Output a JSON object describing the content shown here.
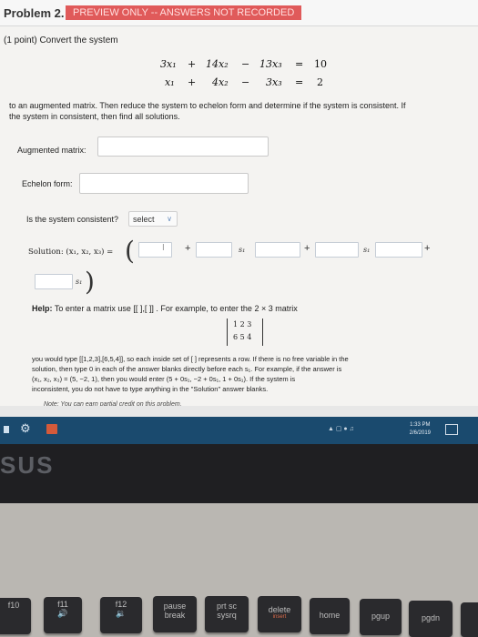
{
  "header": {
    "problem_title": "Problem 2.",
    "preview_badge": "PREVIEW ONLY -- ANSWERS NOT RECORDED"
  },
  "question": {
    "prompt_line": "(1 point) Convert the system",
    "system": [
      {
        "a": "3x₁",
        "op1": "+",
        "b": "14x₂",
        "op2": "−",
        "c": "13x₃",
        "eq": "=",
        "rhs": "10"
      },
      {
        "a": "x₁",
        "op1": "+",
        "b": "4x₂",
        "op2": "−",
        "c": "3x₃",
        "eq": "=",
        "rhs": "2"
      }
    ],
    "instruction_line1": "to an augmented matrix. Then reduce the system to echelon form and determine if the system is consistent. If",
    "instruction_line2": "the system in consistent, then find all solutions."
  },
  "fields": {
    "augmented_label": "Augmented matrix:",
    "echelon_label": "Echelon form:",
    "consistent_label": "Is the system consistent?",
    "consistent_select": "select",
    "solution_label": "Solution: (x₁, x₂, x₃) =",
    "plus": "+",
    "s1": "s₁"
  },
  "help": {
    "help_bold": "Help:",
    "help_text": "To enter a matrix use [[ ],[ ]] . For example, to enter the 2 × 3 matrix",
    "matrix_row1": "1   2   3",
    "matrix_row2": "6   5   4",
    "para1": "you would type [[1,2,3],[6,5,4]], so each inside set of [ ] represents a row. If there is no free variable in the",
    "para2": "solution, then type 0 in each of the answer blanks directly before each s₁. For example, if the answer is",
    "para3": "(x₁, x₂, x₃) = (5, −2, 1), then you would enter (5 + 0s₁, −2 + 0s₁, 1 + 0s₁). If the system is",
    "para4": "inconsistent, you do not have to type anything in the \"Solution\" answer blanks.",
    "note": "Note: You can earn partial credit on this problem."
  },
  "taskbar": {
    "time": "1:33 PM",
    "date": "2/6/2019"
  },
  "hardware": {
    "logo": "SUS",
    "keys": [
      {
        "top": "f10",
        "bottom": ""
      },
      {
        "top": "f11",
        "bottom": ""
      },
      {
        "top": "f12",
        "bottom": ""
      },
      {
        "top": "pause",
        "bottom": "break"
      },
      {
        "top": "prt sc",
        "bottom": "sysrq"
      },
      {
        "top": "delete",
        "bottom": "insert"
      },
      {
        "top": "home",
        "bottom": ""
      },
      {
        "top": "pgup",
        "bottom": ""
      },
      {
        "top": "pgdn",
        "bottom": ""
      }
    ]
  }
}
